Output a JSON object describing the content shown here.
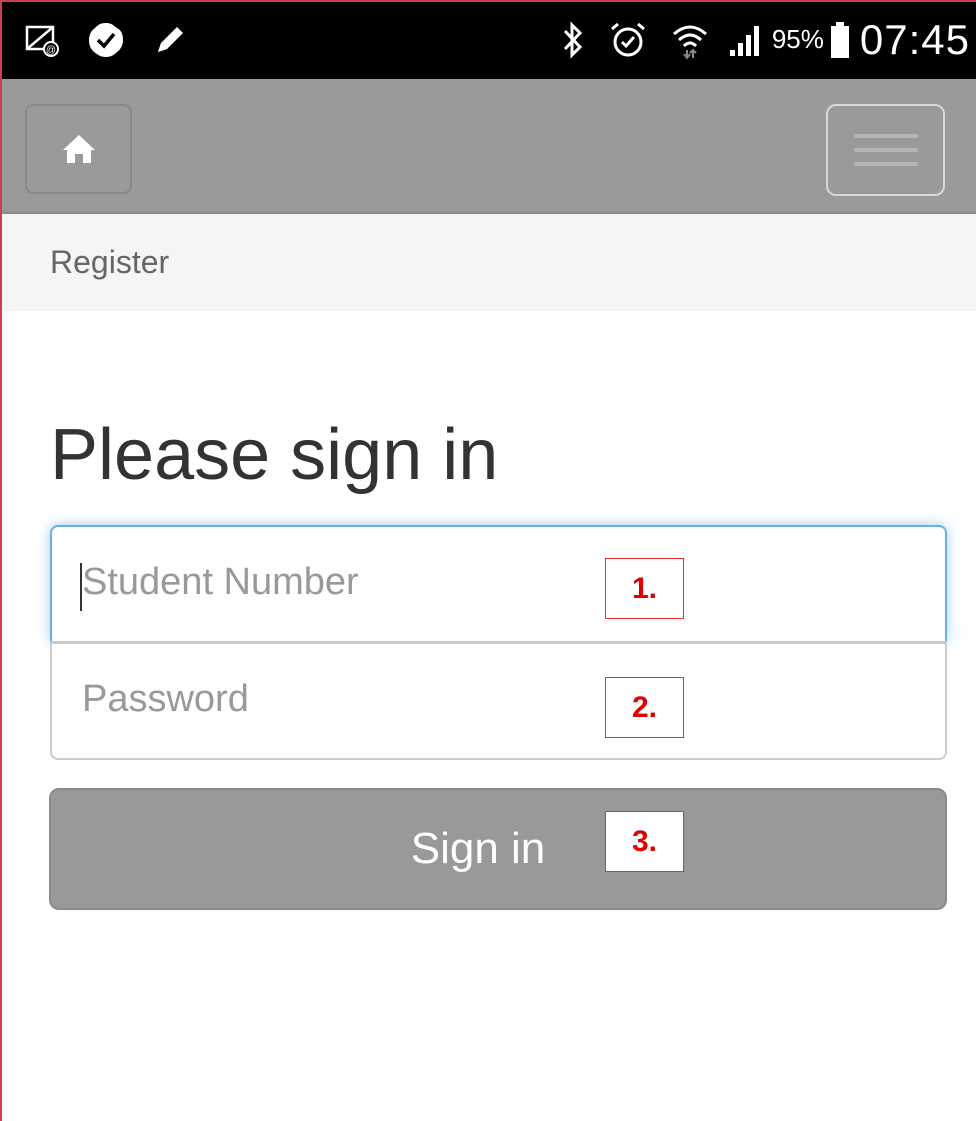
{
  "status_bar": {
    "icons_left": [
      "email-notification-icon",
      "check-badge-icon",
      "pencil-icon"
    ],
    "icons_right": [
      "bluetooth-icon",
      "alarm-icon",
      "wifi-icon",
      "signal-icon",
      "battery-icon"
    ],
    "battery_percent": "95%",
    "time": "07:45"
  },
  "navbar": {
    "home_icon": "home-icon",
    "menu_icon": "hamburger-menu-icon"
  },
  "breadcrumb": {
    "link": "Register"
  },
  "form": {
    "title": "Please sign in",
    "student_number_placeholder": "Student Number",
    "password_placeholder": "Password",
    "submit_label": "Sign in"
  },
  "annotations": [
    "1.",
    "2.",
    "3."
  ],
  "colors": {
    "navbar_bg": "#9a9a9a",
    "button_bg": "#999999",
    "focus_border": "#66afe9",
    "annotation": "#e00000"
  }
}
